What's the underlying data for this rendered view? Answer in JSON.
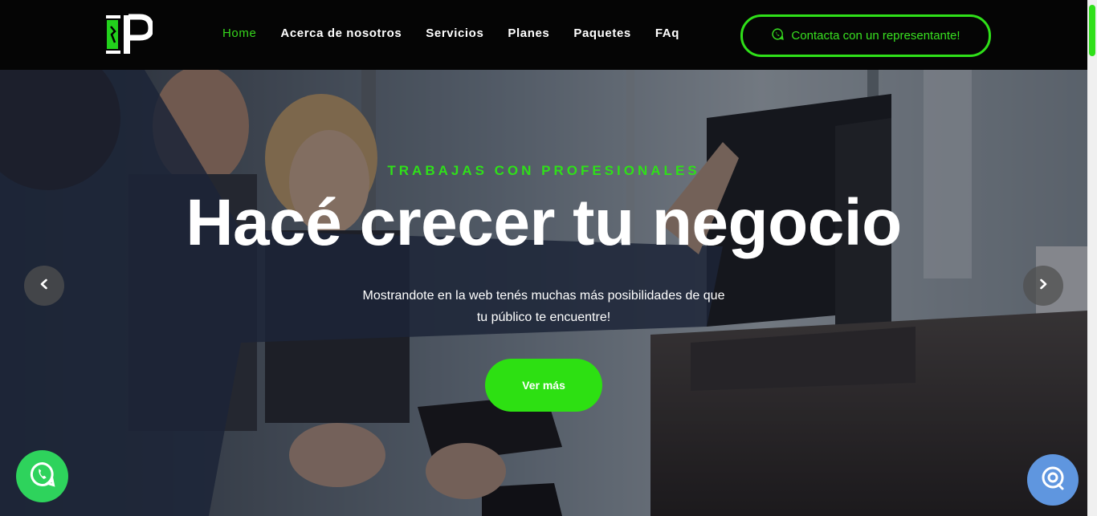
{
  "header": {
    "logo_icon": "ip-logo",
    "nav": [
      {
        "label": "Home",
        "active": true
      },
      {
        "label": "Acerca de nosotros",
        "active": false
      },
      {
        "label": "Servicios",
        "active": false
      },
      {
        "label": "Planes",
        "active": false
      },
      {
        "label": "Paquetes",
        "active": false
      },
      {
        "label": "FAq",
        "active": false
      }
    ],
    "cta": {
      "label": "Contacta con un representante!",
      "icon": "whatsapp-icon"
    }
  },
  "hero": {
    "eyebrow": "TRABAJAS CON PROFESIONALES",
    "title": "Hacé crecer tu negocio",
    "subtitle_line1": "Mostrandote en la web tenés muchas más posibilidades de que",
    "subtitle_line2": "tu público te encuentre!",
    "button_label": "Ver más",
    "prev_icon": "chevron-left-icon",
    "next_icon": "chevron-right-icon"
  },
  "floating": {
    "whatsapp_icon": "whatsapp-icon",
    "chat_icon": "chat-bubble-icon"
  },
  "colors": {
    "accent": "#2fe019",
    "header_bg": "#050505",
    "whatsapp": "#2ed35c",
    "chat": "#5f96df"
  }
}
